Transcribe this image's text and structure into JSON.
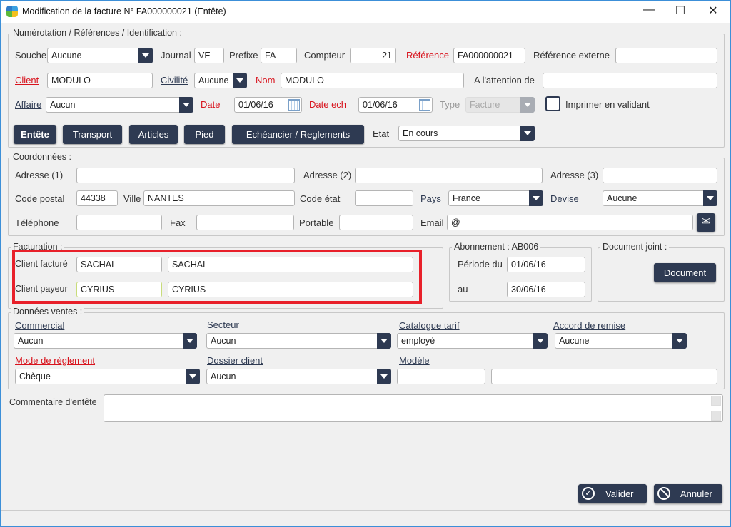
{
  "window": {
    "title": "Modification de la facture  N° FA000000021 (Entête)",
    "minimize": "—",
    "maximize": "☐",
    "close": "✕"
  },
  "numerotation": {
    "legend": "Numérotation / Références / Identification :",
    "souche_label": "Souche",
    "souche": "Aucune",
    "journal_label": "Journal",
    "journal": "VE",
    "prefixe_label": "Prefixe",
    "prefixe": "FA",
    "compteur_label": "Compteur",
    "compteur": "21",
    "reference_label": "Référence",
    "reference": "FA000000021",
    "ref_externe_label": "Référence externe",
    "ref_externe": "",
    "client_label": "Client",
    "client": "MODULO",
    "civilite_label": "Civilité",
    "civilite": "Aucune",
    "nom_label": "Nom",
    "nom": "MODULO",
    "attention_label": "A l'attention de",
    "attention": "",
    "affaire_label": "Affaire",
    "affaire": "Aucun",
    "date_label": "Date",
    "date": "01/06/16",
    "date_ech_label": "Date ech",
    "date_ech": "01/06/16",
    "type_label": "Type",
    "type": "Facture",
    "imprimer_label": "Imprimer en validant",
    "imprimer_checked": false,
    "etat_label": "Etat",
    "etat": "En cours"
  },
  "tabs": [
    "Entête",
    "Transport",
    "Articles",
    "Pied",
    "Echéancier / Reglements"
  ],
  "coordonnees": {
    "legend": "Coordonnées :",
    "adresse1_label": "Adresse (1)",
    "adresse1": "",
    "adresse2_label": "Adresse (2)",
    "adresse2": "",
    "adresse3_label": "Adresse (3)",
    "adresse3": "",
    "cp_label": "Code postal",
    "cp": "44338",
    "ville_label": "Ville",
    "ville": "NANTES",
    "code_etat_label": "Code état",
    "code_etat": "",
    "pays_label": "Pays",
    "pays": "France",
    "devise_label": "Devise",
    "devise": "Aucune",
    "tel_label": "Téléphone",
    "tel": "",
    "fax_label": "Fax",
    "fax": "",
    "portable_label": "Portable",
    "portable": "",
    "email_label": "Email",
    "email": "@"
  },
  "facturation": {
    "legend": "Facturation :",
    "facture_label": "Client facturé",
    "facture_code": "SACHAL",
    "facture_nom": "SACHAL",
    "payeur_label": "Client payeur",
    "payeur_code": "CYRIUS",
    "payeur_nom": "CYRIUS",
    "highlight_color": "#e8202a"
  },
  "abonnement": {
    "legend": "Abonnement : AB006",
    "du_label": "Période du",
    "du": "01/06/16",
    "au_label": "au",
    "au": "30/06/16"
  },
  "document": {
    "legend": "Document joint :",
    "button": "Document"
  },
  "ventes": {
    "legend": "Données ventes :",
    "commercial_label": "Commercial",
    "commercial": "Aucun",
    "secteur_label": "Secteur",
    "secteur": "Aucun",
    "catalogue_label": "Catalogue tarif",
    "catalogue": "employé",
    "accord_label": "Accord de remise",
    "accord": "Aucune",
    "reglement_label": "Mode de règlement",
    "reglement": "Chèque",
    "dossier_label": "Dossier client",
    "dossier": "Aucun",
    "modele_label": "Modèle",
    "modele1": "",
    "modele2": ""
  },
  "commentaire": {
    "label": "Commentaire d'entête",
    "value": ""
  },
  "actions": {
    "valider": "Valider",
    "annuler": "Annuler"
  },
  "colors": {
    "accent": "#2e3a52",
    "required": "#d8131d"
  }
}
